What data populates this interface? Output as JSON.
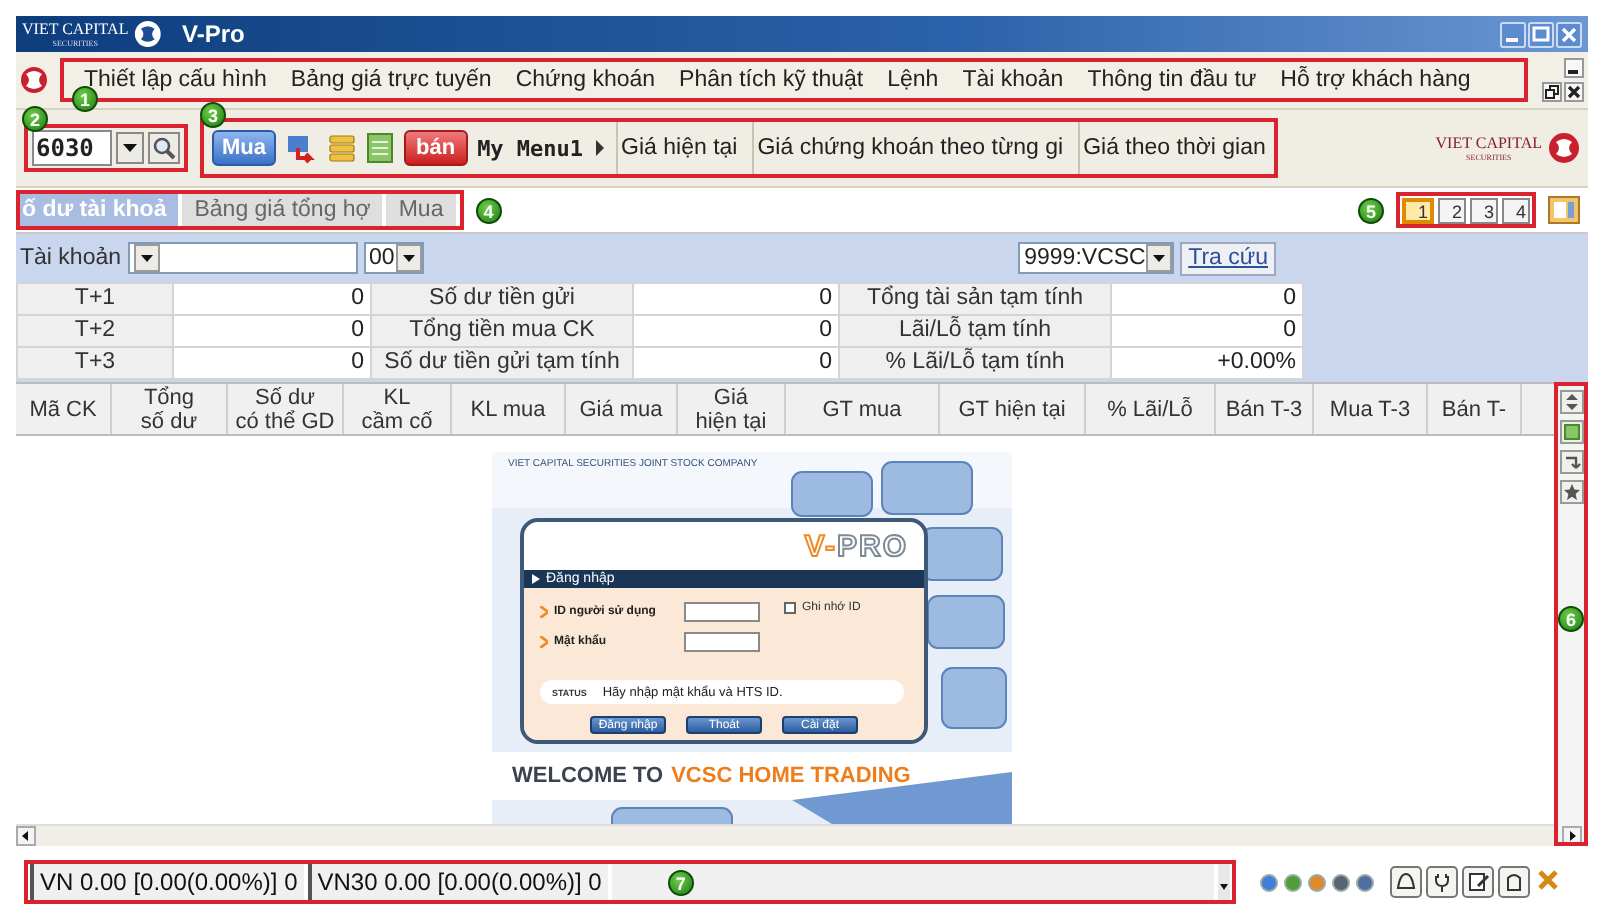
{
  "window": {
    "logo_top": "VIET CAPITAL",
    "logo_bottom": "SECURITIES",
    "title": "V-Pro"
  },
  "menu": {
    "annotation": "1",
    "items": [
      "Thiết lập cấu hình",
      "Bảng giá trực tuyến",
      "Chứng khoán",
      "Phân tích kỹ thuật",
      "Lệnh",
      "Tài khoản",
      "Thông tin đầu tư",
      "Hỗ trợ khách hàng"
    ]
  },
  "toolbar": {
    "symbol_annotation": "2",
    "symbol": "6030",
    "annotation": "3",
    "buy": "Mua",
    "sell": "bán",
    "my_menu": "My Menu1",
    "logo_top": "VIET CAPITAL",
    "logo_bottom": "SECURITIES",
    "tabs": [
      {
        "label": "Giá hiện tại",
        "selected": false
      },
      {
        "label": "Giá chứng khoán theo từng gi",
        "selected": false
      },
      {
        "label": "Giá theo thời gian",
        "selected": false
      }
    ]
  },
  "tabs": {
    "annotation": "4",
    "items": [
      {
        "label": "ố dư tài khoả",
        "selected": true
      },
      {
        "label": "Bảng giá tổng hợ",
        "selected": false
      },
      {
        "label": "Mua",
        "selected": false
      }
    ]
  },
  "pages": {
    "annotation": "5",
    "items": [
      {
        "label": "1",
        "selected": true
      },
      {
        "label": "2",
        "selected": false
      },
      {
        "label": "3",
        "selected": false
      },
      {
        "label": "4",
        "selected": false
      }
    ]
  },
  "account": {
    "label": "Tài khoản",
    "sub_account": "00",
    "branch": "9999:VCSC",
    "lookup": "Tra cứu"
  },
  "summary": {
    "rows": [
      [
        "T+1",
        "0",
        "Số dư tiền gửi",
        "0",
        "Tổng tài sản tạm tính",
        "0"
      ],
      [
        "T+2",
        "0",
        "Tổng tiền mua CK",
        "0",
        "Lãi/Lỗ tạm tính",
        "0"
      ],
      [
        "T+3",
        "0",
        "Số dư tiền gửi tạm tính",
        "0",
        "% Lãi/Lỗ tạm tính",
        "+0.00%"
      ]
    ]
  },
  "grid": {
    "annotation": "6",
    "columns": [
      "Mã CK",
      "Tổng\nsố dư",
      "Số dư\ncó thể GD",
      "KL\ncầm cố",
      "KL mua",
      "Giá mua",
      "Giá\nhiện tại",
      "GT mua",
      "GT hiện tại",
      "% Lãi/Lỗ",
      "Bán T-3",
      "Mua T-3",
      "Bán T-"
    ]
  },
  "splash": {
    "company": "VIET CAPITAL SECURITIES JOINT STOCK COMPANY",
    "logo_accent": "V-",
    "logo_rest": "PRO",
    "section": "Đăng nhập",
    "user_label": "ID người sử dụng",
    "password_label": "Mật khẩu",
    "remember": "Ghi nhớ ID",
    "remember_checked": false,
    "status_label": "STATUS",
    "status": "Hãy nhập mật khẩu và HTS ID.",
    "buttons": [
      "Đăng nhập",
      "Thoát",
      "Cài đặt"
    ],
    "welcome": "WELCOME TO",
    "brand": "VCSC HOME TRADING"
  },
  "status_bar": {
    "annotation": "7",
    "indices": [
      "VN 0.00 [0.00(0.00%)] 0",
      "VN30 0.00 [0.00(0.00%)] 0"
    ],
    "lights": [
      {
        "color": "#3f7fd6"
      },
      {
        "color": "#4e9f3a"
      },
      {
        "color": "#e08a2a"
      },
      {
        "color": "#5b6470"
      },
      {
        "color": "#4f6f9f"
      }
    ]
  }
}
